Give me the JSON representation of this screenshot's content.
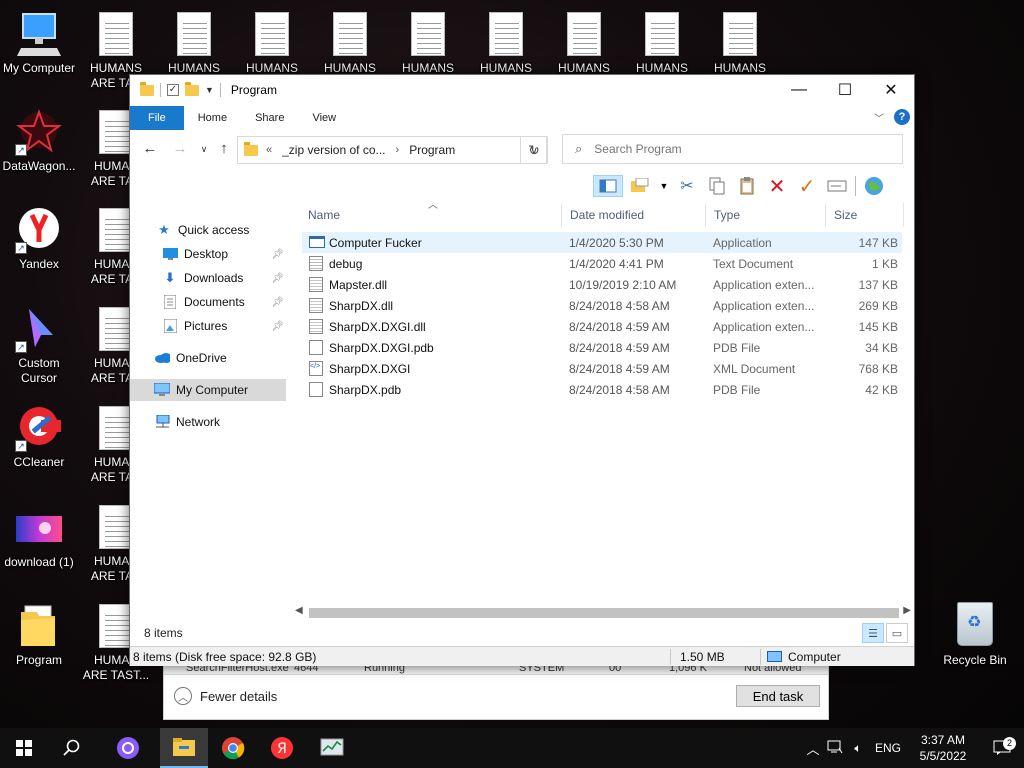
{
  "desktop": {
    "left_column": [
      {
        "label": "My Computer",
        "icon": "monitor-icon"
      },
      {
        "label": "DataWagon...",
        "icon": "datawagon-icon"
      },
      {
        "label": "Yandex",
        "icon": "yandex-browser-icon"
      },
      {
        "label": "Custom\nCursor",
        "icon": "custom-cursor-icon"
      },
      {
        "label": "CCleaner",
        "icon": "ccleaner-icon"
      },
      {
        "label": "download (1)",
        "icon": "image-thumbnail-icon"
      },
      {
        "label": "Program",
        "icon": "folder-icon"
      }
    ],
    "humans_column": [
      {
        "label": "HUMANS\nARE TAS"
      },
      {
        "label": "HUMAN\nARE TAS"
      },
      {
        "label": "HUMAN\nARE TAS"
      },
      {
        "label": "HUMAN\nARE TAS"
      },
      {
        "label": "HUMAN\nARE TAS"
      },
      {
        "label": "HUMAN\nARE TAS"
      },
      {
        "label": "HUMAN\nARE TAST..."
      }
    ],
    "top_row": [
      "HUMANS",
      "HUMANS",
      "HUMANS",
      "HUMANS",
      "HUMANS",
      "HUMANS",
      "HUMANS",
      "HUMANS"
    ],
    "recycle_bin": "Recycle Bin"
  },
  "task_manager": {
    "ghost_row": [
      "SearchFilterHost.exe",
      "4644",
      "Running",
      "SYSTEM",
      "00",
      "1,096 K",
      "Not allowed"
    ],
    "fewer_details": "Fewer details",
    "end_task": "End task"
  },
  "explorer": {
    "title": "Program",
    "ribbon_tabs": [
      "File",
      "Home",
      "Share",
      "View"
    ],
    "address": {
      "overflow": "«",
      "parent": "_zip version of co...",
      "current": "Program"
    },
    "search_placeholder": "Search Program",
    "columns": {
      "name": "Name",
      "date": "Date modified",
      "type": "Type",
      "size": "Size"
    },
    "nav": [
      {
        "label": "Quick access",
        "icon": "star-icon",
        "pinned": false
      },
      {
        "label": "Desktop",
        "icon": "desktop-icon",
        "pinned": true
      },
      {
        "label": "Downloads",
        "icon": "download-arrow-icon",
        "pinned": true
      },
      {
        "label": "Documents",
        "icon": "documents-icon",
        "pinned": true
      },
      {
        "label": "Pictures",
        "icon": "pictures-icon",
        "pinned": true
      },
      {
        "label": "OneDrive",
        "icon": "cloud-icon",
        "pinned": false
      },
      {
        "label": "My Computer",
        "icon": "monitor-icon",
        "pinned": false,
        "selected": true
      },
      {
        "label": "Network",
        "icon": "network-icon",
        "pinned": false
      }
    ],
    "files": [
      {
        "name": "Computer Fucker",
        "date": "1/4/2020 5:30 PM",
        "type": "Application",
        "size": "147 KB",
        "icon": "app"
      },
      {
        "name": "debug",
        "date": "1/4/2020 4:41 PM",
        "type": "Text Document",
        "size": "1 KB",
        "icon": "txt"
      },
      {
        "name": "Mapster.dll",
        "date": "10/19/2019 2:10 AM",
        "type": "Application exten...",
        "size": "137 KB",
        "icon": "dll"
      },
      {
        "name": "SharpDX.dll",
        "date": "8/24/2018 4:58 AM",
        "type": "Application exten...",
        "size": "269 KB",
        "icon": "dll"
      },
      {
        "name": "SharpDX.DXGI.dll",
        "date": "8/24/2018 4:59 AM",
        "type": "Application exten...",
        "size": "145 KB",
        "icon": "dll"
      },
      {
        "name": "SharpDX.DXGI.pdb",
        "date": "8/24/2018 4:59 AM",
        "type": "PDB File",
        "size": "34 KB",
        "icon": "pdb"
      },
      {
        "name": "SharpDX.DXGI",
        "date": "8/24/2018 4:59 AM",
        "type": "XML Document",
        "size": "768 KB",
        "icon": "xml"
      },
      {
        "name": "SharpDX.pdb",
        "date": "8/24/2018 4:58 AM",
        "type": "PDB File",
        "size": "42 KB",
        "icon": "pdb"
      }
    ],
    "status_count": "8 items",
    "details_bar": {
      "summary": "8 items (Disk free space: 92.8 GB)",
      "size": "1.50 MB",
      "location": "Computer"
    }
  },
  "taskbar": {
    "language": "ENG",
    "time": "3:37 AM",
    "date": "5/5/2022",
    "notifications": "2"
  },
  "colors": {
    "file_tab": "#1979ca",
    "selection": "#e5f3ff",
    "nav_selected": "#d9d9d9"
  }
}
